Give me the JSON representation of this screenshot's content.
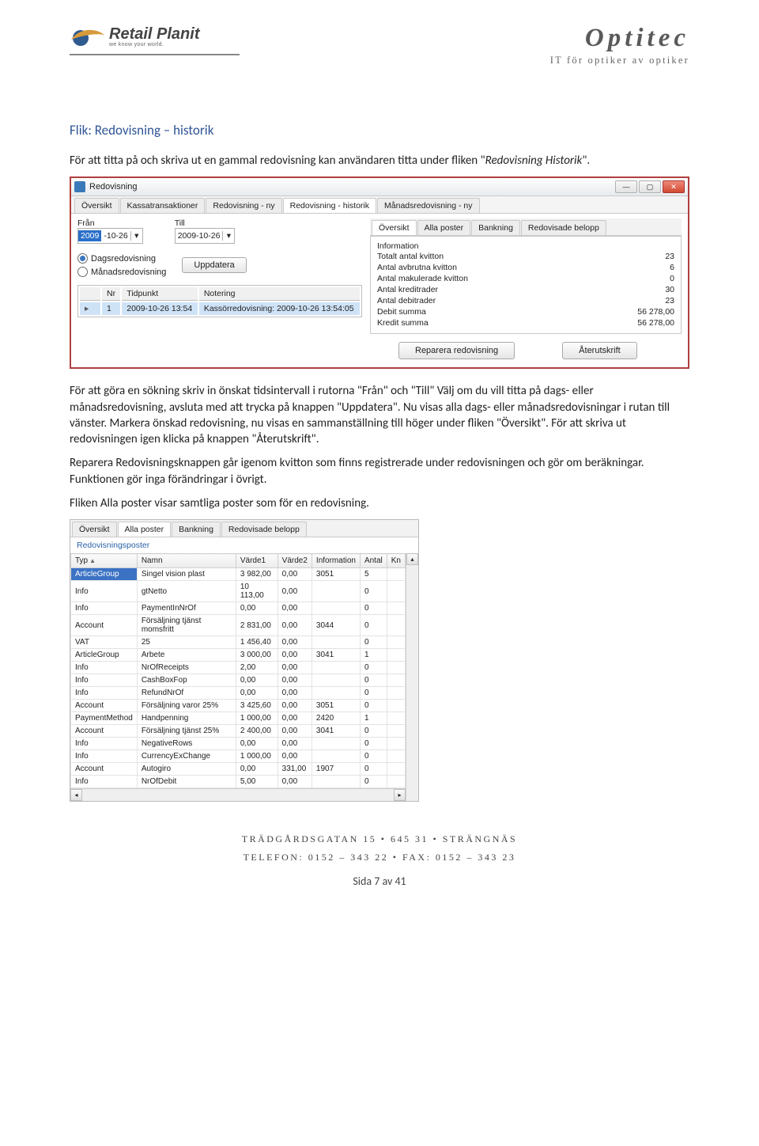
{
  "logo": {
    "name": "Retail Planit",
    "tagline": "we know your world."
  },
  "brand": {
    "title": "Optitec",
    "subtitle": "IT för optiker av optiker"
  },
  "section_title": "Flik: Redovisning – historik",
  "para1a": "För att titta på och skriva ut en gammal redovisning kan användaren titta under fliken \"",
  "para1b": "Redovisning Historik",
  "para1c": "\".",
  "shot1": {
    "window_title": "Redovisning",
    "main_tabs": [
      "Översikt",
      "Kassatransaktioner",
      "Redovisning - ny",
      "Redovisning - historik",
      "Månadsredovisning - ny"
    ],
    "active_main_tab": 3,
    "labels": {
      "fran": "Från",
      "till": "Till"
    },
    "date_from": {
      "sel": "2009",
      "rest": "-10-26"
    },
    "date_to": {
      "sel": "",
      "rest": "2009-10-26"
    },
    "radios": {
      "dags": "Dagsredovisning",
      "manads": "Månadsredovisning"
    },
    "update_btn": "Uppdatera",
    "grid_headers": [
      "Nr",
      "Tidpunkt",
      "Notering"
    ],
    "grid_row": {
      "nr": "1",
      "tid": "2009-10-26 13:54",
      "not": "Kassörredovisning: 2009-10-26 13:54:05"
    },
    "sub_tabs": [
      "Översikt",
      "Alla poster",
      "Bankning",
      "Redovisade belopp"
    ],
    "active_sub_tab": 0,
    "info_title": "Information",
    "info_rows": [
      {
        "k": "Totalt antal kvitton",
        "v": "23"
      },
      {
        "k": "Antal avbrutna kvitton",
        "v": "6"
      },
      {
        "k": "Antal makulerade kvitton",
        "v": "0"
      },
      {
        "k": "Antal kreditrader",
        "v": "30"
      },
      {
        "k": "Antal debitrader",
        "v": "23"
      },
      {
        "k": "Debit summa",
        "v": "56 278,00"
      },
      {
        "k": "Kredit summa",
        "v": "56 278,00"
      }
    ],
    "btn_repair": "Reparera redovisning",
    "btn_reprint": "Återutskrift"
  },
  "para2": "För att göra en sökning skriv in önskat tidsintervall i rutorna \"Från\" och \"Till\" Välj om du vill titta på dags- eller månadsredovisning, avsluta med att trycka på knappen \"Uppdatera\". Nu visas alla dags- eller månadsredovisningar i rutan till vänster. Markera önskad redovisning, nu visas en sammanställning till höger under fliken \"Översikt\". För att skriva ut redovisningen igen klicka på knappen \"Återutskrift\".",
  "para3": "Reparera Redovisningsknappen går igenom kvitton som finns registrerade under redovisningen och gör om beräkningar. Funktionen gör inga förändringar i övrigt.",
  "para4": "Fliken Alla poster visar samtliga poster som för en redovisning.",
  "shot2": {
    "tabs": [
      "Översikt",
      "Alla poster",
      "Bankning",
      "Redovisade belopp"
    ],
    "active_tab": 1,
    "group_label": "Redovisningsposter",
    "headers": [
      "Typ",
      "Namn",
      "Värde1",
      "Värde2",
      "Information",
      "Antal",
      "Kn"
    ],
    "rows": [
      [
        "ArticleGroup",
        "Singel vision plast",
        "3 982,00",
        "0,00",
        "3051",
        "5",
        ""
      ],
      [
        "Info",
        "gtNetto",
        "10 113,00",
        "0,00",
        "",
        "0",
        ""
      ],
      [
        "Info",
        "PaymentInNrOf",
        "0,00",
        "0,00",
        "",
        "0",
        ""
      ],
      [
        "Account",
        "Försäljning tjänst momsfritt",
        "2 831,00",
        "0,00",
        "3044",
        "0",
        ""
      ],
      [
        "VAT",
        "25",
        "1 456,40",
        "0,00",
        "",
        "0",
        ""
      ],
      [
        "ArticleGroup",
        "Arbete",
        "3 000,00",
        "0,00",
        "3041",
        "1",
        ""
      ],
      [
        "Info",
        "NrOfReceipts",
        "2,00",
        "0,00",
        "",
        "0",
        ""
      ],
      [
        "Info",
        "CashBoxFop",
        "0,00",
        "0,00",
        "",
        "0",
        ""
      ],
      [
        "Info",
        "RefundNrOf",
        "0,00",
        "0,00",
        "",
        "0",
        ""
      ],
      [
        "Account",
        "Försäljning varor 25%",
        "3 425,60",
        "0,00",
        "3051",
        "0",
        ""
      ],
      [
        "PaymentMethod",
        "Handpenning",
        "1 000,00",
        "0,00",
        "2420",
        "1",
        ""
      ],
      [
        "Account",
        "Försäljning tjänst 25%",
        "2 400,00",
        "0,00",
        "3041",
        "0",
        ""
      ],
      [
        "Info",
        "NegativeRows",
        "0,00",
        "0,00",
        "",
        "0",
        ""
      ],
      [
        "Info",
        "CurrencyExChange",
        "1 000,00",
        "0,00",
        "",
        "0",
        ""
      ],
      [
        "Account",
        "Autogiro",
        "0,00",
        "331,00",
        "1907",
        "0",
        ""
      ],
      [
        "Info",
        "NrOfDebit",
        "5,00",
        "0,00",
        "",
        "0",
        ""
      ]
    ]
  },
  "footer": {
    "line1": "TRÄDGÅRDSGATAN 15 • 645 31 • STRÄNGNÄS",
    "line2": "TELEFON: 0152 – 343 22 • FAX: 0152 – 343 23",
    "page": "Sida 7 av 41"
  }
}
